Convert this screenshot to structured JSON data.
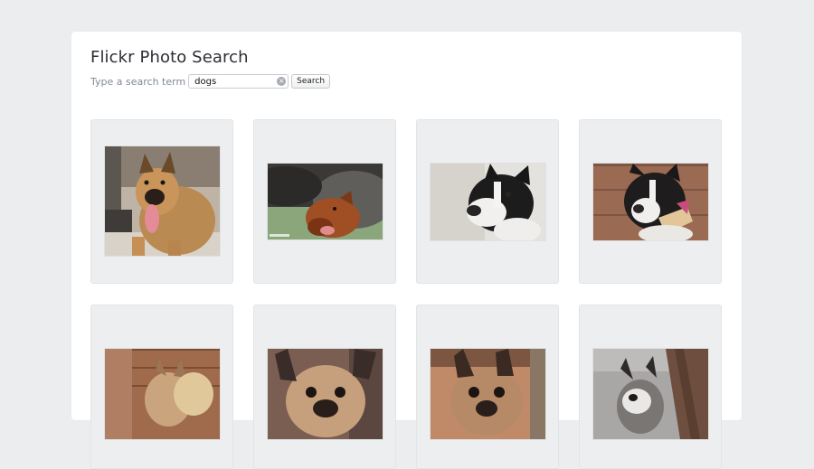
{
  "app": {
    "title": "Flickr Photo Search"
  },
  "search": {
    "label": "Type a search term",
    "value": "dogs",
    "clear_icon": "×",
    "button_label": "Search"
  },
  "results": [
    {
      "subject": "German Shepherd with tongue out"
    },
    {
      "subject": "Puppy nursing under mother"
    },
    {
      "subject": "Boston Terrier on white background"
    },
    {
      "subject": "Boston Terrier with bandana against brick"
    },
    {
      "subject": "French Bulldog by brick wall"
    },
    {
      "subject": "French Bulldog face close-up"
    },
    {
      "subject": "French Bulldog on sand"
    },
    {
      "subject": "French Bulldog on wooden deck"
    }
  ],
  "colors": {
    "page_background": "#ecedef",
    "panel_background": "#ffffff",
    "card_background": "#eceeef",
    "title_text": "#2c2e33",
    "label_text": "#818a96"
  }
}
